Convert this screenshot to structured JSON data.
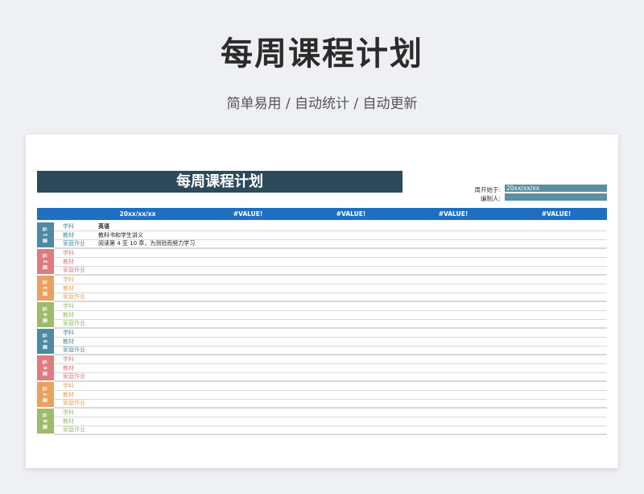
{
  "page": {
    "title": "每周课程计划",
    "subtitle": "简单易用 / 自动统计 / 自动更新"
  },
  "sheet": {
    "banner_title": "每周课程计划",
    "week_start_label": "周开始于:",
    "week_start_value": "20xx/xx/xx",
    "editor_label": "编制人:",
    "editor_value": "",
    "header": {
      "date": "20xx/xx/xx",
      "col2": "#VALUE!",
      "col3": "#VALUE!",
      "col4": "#VALUE!",
      "col5": "#VALUE!"
    },
    "row_labels": {
      "subject": "学科",
      "material": "教材",
      "homework": "家庭作业"
    },
    "periods": [
      {
        "label": "第 1 节",
        "color": "#4d8aa3",
        "subject": "英语",
        "material": "教科书和学生讲义",
        "homework": "阅读第 4 至 10 章，为测验而努力学习"
      },
      {
        "label": "第 2 节",
        "color": "#e07a7f",
        "subject": "",
        "material": "",
        "homework": ""
      },
      {
        "label": "第 3 节",
        "color": "#eaa15f",
        "subject": "",
        "material": "",
        "homework": ""
      },
      {
        "label": "第 4 节",
        "color": "#9dbb6a",
        "subject": "",
        "material": "",
        "homework": ""
      },
      {
        "label": "第 5 节",
        "color": "#4d8aa3",
        "subject": "",
        "material": "",
        "homework": ""
      },
      {
        "label": "第 6 节",
        "color": "#e07a7f",
        "subject": "",
        "material": "",
        "homework": ""
      },
      {
        "label": "第 7 节",
        "color": "#eaa15f",
        "subject": "",
        "material": "",
        "homework": ""
      },
      {
        "label": "第 8 节",
        "color": "#9dbb6a",
        "subject": "",
        "material": "",
        "homework": ""
      }
    ]
  }
}
